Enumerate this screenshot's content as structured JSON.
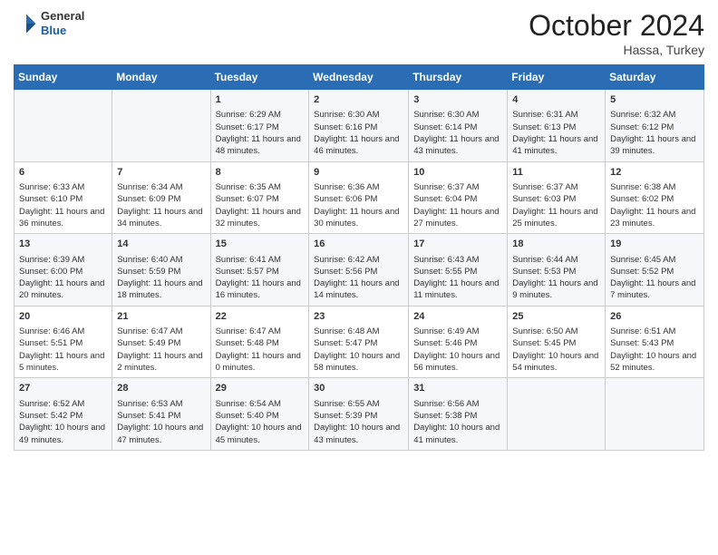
{
  "header": {
    "logo_general": "General",
    "logo_blue": "Blue",
    "month": "October 2024",
    "location": "Hassa, Turkey"
  },
  "days_of_week": [
    "Sunday",
    "Monday",
    "Tuesday",
    "Wednesday",
    "Thursday",
    "Friday",
    "Saturday"
  ],
  "weeks": [
    [
      {
        "day": "",
        "sunrise": "",
        "sunset": "",
        "daylight": ""
      },
      {
        "day": "",
        "sunrise": "",
        "sunset": "",
        "daylight": ""
      },
      {
        "day": "1",
        "sunrise": "Sunrise: 6:29 AM",
        "sunset": "Sunset: 6:17 PM",
        "daylight": "Daylight: 11 hours and 48 minutes."
      },
      {
        "day": "2",
        "sunrise": "Sunrise: 6:30 AM",
        "sunset": "Sunset: 6:16 PM",
        "daylight": "Daylight: 11 hours and 46 minutes."
      },
      {
        "day": "3",
        "sunrise": "Sunrise: 6:30 AM",
        "sunset": "Sunset: 6:14 PM",
        "daylight": "Daylight: 11 hours and 43 minutes."
      },
      {
        "day": "4",
        "sunrise": "Sunrise: 6:31 AM",
        "sunset": "Sunset: 6:13 PM",
        "daylight": "Daylight: 11 hours and 41 minutes."
      },
      {
        "day": "5",
        "sunrise": "Sunrise: 6:32 AM",
        "sunset": "Sunset: 6:12 PM",
        "daylight": "Daylight: 11 hours and 39 minutes."
      }
    ],
    [
      {
        "day": "6",
        "sunrise": "Sunrise: 6:33 AM",
        "sunset": "Sunset: 6:10 PM",
        "daylight": "Daylight: 11 hours and 36 minutes."
      },
      {
        "day": "7",
        "sunrise": "Sunrise: 6:34 AM",
        "sunset": "Sunset: 6:09 PM",
        "daylight": "Daylight: 11 hours and 34 minutes."
      },
      {
        "day": "8",
        "sunrise": "Sunrise: 6:35 AM",
        "sunset": "Sunset: 6:07 PM",
        "daylight": "Daylight: 11 hours and 32 minutes."
      },
      {
        "day": "9",
        "sunrise": "Sunrise: 6:36 AM",
        "sunset": "Sunset: 6:06 PM",
        "daylight": "Daylight: 11 hours and 30 minutes."
      },
      {
        "day": "10",
        "sunrise": "Sunrise: 6:37 AM",
        "sunset": "Sunset: 6:04 PM",
        "daylight": "Daylight: 11 hours and 27 minutes."
      },
      {
        "day": "11",
        "sunrise": "Sunrise: 6:37 AM",
        "sunset": "Sunset: 6:03 PM",
        "daylight": "Daylight: 11 hours and 25 minutes."
      },
      {
        "day": "12",
        "sunrise": "Sunrise: 6:38 AM",
        "sunset": "Sunset: 6:02 PM",
        "daylight": "Daylight: 11 hours and 23 minutes."
      }
    ],
    [
      {
        "day": "13",
        "sunrise": "Sunrise: 6:39 AM",
        "sunset": "Sunset: 6:00 PM",
        "daylight": "Daylight: 11 hours and 20 minutes."
      },
      {
        "day": "14",
        "sunrise": "Sunrise: 6:40 AM",
        "sunset": "Sunset: 5:59 PM",
        "daylight": "Daylight: 11 hours and 18 minutes."
      },
      {
        "day": "15",
        "sunrise": "Sunrise: 6:41 AM",
        "sunset": "Sunset: 5:57 PM",
        "daylight": "Daylight: 11 hours and 16 minutes."
      },
      {
        "day": "16",
        "sunrise": "Sunrise: 6:42 AM",
        "sunset": "Sunset: 5:56 PM",
        "daylight": "Daylight: 11 hours and 14 minutes."
      },
      {
        "day": "17",
        "sunrise": "Sunrise: 6:43 AM",
        "sunset": "Sunset: 5:55 PM",
        "daylight": "Daylight: 11 hours and 11 minutes."
      },
      {
        "day": "18",
        "sunrise": "Sunrise: 6:44 AM",
        "sunset": "Sunset: 5:53 PM",
        "daylight": "Daylight: 11 hours and 9 minutes."
      },
      {
        "day": "19",
        "sunrise": "Sunrise: 6:45 AM",
        "sunset": "Sunset: 5:52 PM",
        "daylight": "Daylight: 11 hours and 7 minutes."
      }
    ],
    [
      {
        "day": "20",
        "sunrise": "Sunrise: 6:46 AM",
        "sunset": "Sunset: 5:51 PM",
        "daylight": "Daylight: 11 hours and 5 minutes."
      },
      {
        "day": "21",
        "sunrise": "Sunrise: 6:47 AM",
        "sunset": "Sunset: 5:49 PM",
        "daylight": "Daylight: 11 hours and 2 minutes."
      },
      {
        "day": "22",
        "sunrise": "Sunrise: 6:47 AM",
        "sunset": "Sunset: 5:48 PM",
        "daylight": "Daylight: 11 hours and 0 minutes."
      },
      {
        "day": "23",
        "sunrise": "Sunrise: 6:48 AM",
        "sunset": "Sunset: 5:47 PM",
        "daylight": "Daylight: 10 hours and 58 minutes."
      },
      {
        "day": "24",
        "sunrise": "Sunrise: 6:49 AM",
        "sunset": "Sunset: 5:46 PM",
        "daylight": "Daylight: 10 hours and 56 minutes."
      },
      {
        "day": "25",
        "sunrise": "Sunrise: 6:50 AM",
        "sunset": "Sunset: 5:45 PM",
        "daylight": "Daylight: 10 hours and 54 minutes."
      },
      {
        "day": "26",
        "sunrise": "Sunrise: 6:51 AM",
        "sunset": "Sunset: 5:43 PM",
        "daylight": "Daylight: 10 hours and 52 minutes."
      }
    ],
    [
      {
        "day": "27",
        "sunrise": "Sunrise: 6:52 AM",
        "sunset": "Sunset: 5:42 PM",
        "daylight": "Daylight: 10 hours and 49 minutes."
      },
      {
        "day": "28",
        "sunrise": "Sunrise: 6:53 AM",
        "sunset": "Sunset: 5:41 PM",
        "daylight": "Daylight: 10 hours and 47 minutes."
      },
      {
        "day": "29",
        "sunrise": "Sunrise: 6:54 AM",
        "sunset": "Sunset: 5:40 PM",
        "daylight": "Daylight: 10 hours and 45 minutes."
      },
      {
        "day": "30",
        "sunrise": "Sunrise: 6:55 AM",
        "sunset": "Sunset: 5:39 PM",
        "daylight": "Daylight: 10 hours and 43 minutes."
      },
      {
        "day": "31",
        "sunrise": "Sunrise: 6:56 AM",
        "sunset": "Sunset: 5:38 PM",
        "daylight": "Daylight: 10 hours and 41 minutes."
      },
      {
        "day": "",
        "sunrise": "",
        "sunset": "",
        "daylight": ""
      },
      {
        "day": "",
        "sunrise": "",
        "sunset": "",
        "daylight": ""
      }
    ]
  ]
}
